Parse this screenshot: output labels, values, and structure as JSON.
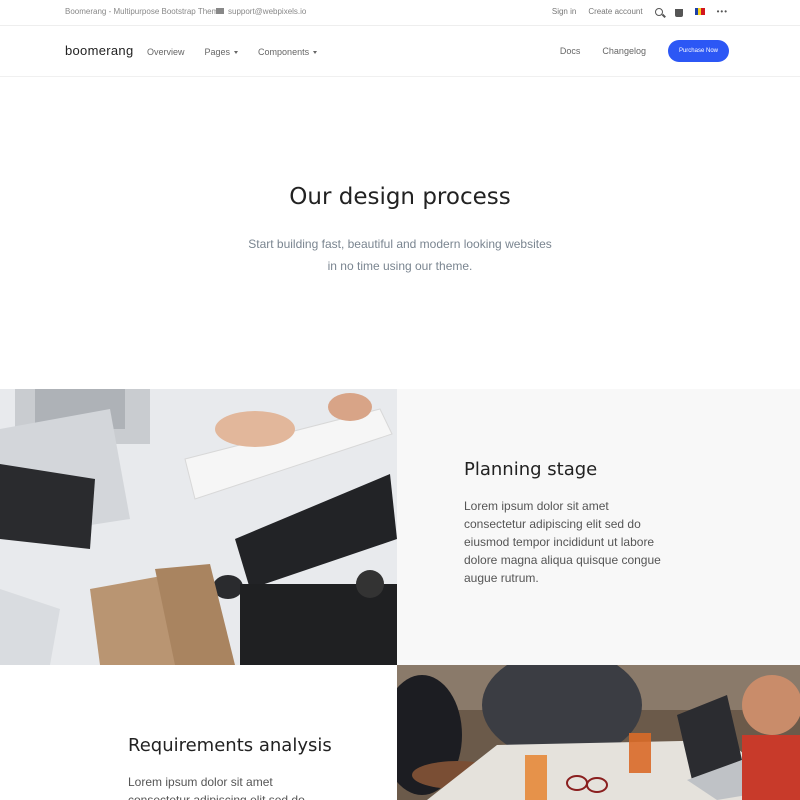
{
  "topbar": {
    "theme_name": "Boomerang - Multipurpose Bootstrap Theme",
    "email": "support@webpixels.io",
    "sign_in": "Sign in",
    "create_account": "Create account",
    "more": "•••"
  },
  "nav": {
    "logo": "boomerang",
    "links": [
      "Overview",
      "Pages",
      "Components"
    ],
    "docs": "Docs",
    "changelog": "Changelog",
    "purchase": "Purchase Now",
    "accent": "#2c57f5"
  },
  "hero": {
    "title": "Our design process",
    "subtitle_line1": "Start building fast, beautiful and modern looking websites",
    "subtitle_line2": "in no time using our theme."
  },
  "features": [
    {
      "title": "Planning stage",
      "text": "Lorem ipsum dolor sit amet consectetur adipiscing elit sed do eiusmod tempor incididunt ut labore dolore magna aliqua quisque congue augue rutrum."
    },
    {
      "title": "Requirements analysis",
      "text": "Lorem ipsum dolor sit amet consectetur adipiscing elit sed do"
    }
  ]
}
